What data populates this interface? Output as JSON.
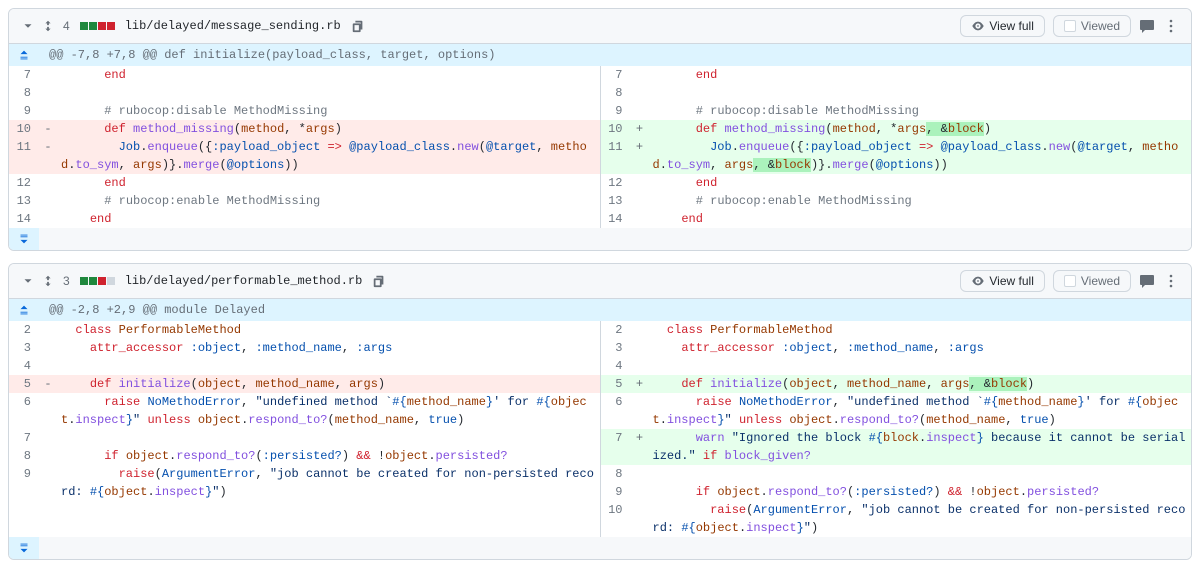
{
  "ui": {
    "view_full": "View full",
    "viewed": "Viewed",
    "eye": "eye-icon",
    "comment": "comment-icon",
    "kebab": "kebab-icon"
  },
  "files": [
    {
      "path": "lib/delayed/message_sending.rb",
      "change_count": "4",
      "diffstat": [
        "add",
        "add",
        "del",
        "del"
      ],
      "hunk_header": "@@ -7,8 +7,8 @@ def initialize(payload_class, target, options)",
      "left": [
        {
          "n": "7",
          "m": "",
          "type": "ctx",
          "html": "      <span class='kw-red'>end</span>"
        },
        {
          "n": "8",
          "m": "",
          "type": "ctx",
          "html": ""
        },
        {
          "n": "9",
          "m": "",
          "type": "ctx",
          "html": "      <span class='kw-gray'># rubocop:disable MethodMissing</span>"
        },
        {
          "n": "10",
          "m": "-",
          "type": "del",
          "html": "      <span class='kw-red'>def</span> <span class='kw-purple'>method_missing</span>(<span class='kw-orange'>method</span>, *<span class='kw-orange'>args</span>)"
        },
        {
          "n": "11",
          "m": "-",
          "type": "del",
          "html": "        <span class='kw-blue'>Job</span>.<span class='kw-purple'>enqueue</span>({<span class='kw-blue'>:payload_object</span> <span class='kw-red'>=&gt;</span> <span class='kw-blue'>@payload_class</span>.<span class='kw-purple'>new</span>(<span class='kw-blue'>@target</span>, <span class='kw-orange'>method</span>.<span class='kw-purple'>to_sym</span>, <span class='kw-orange'>args</span>)}.<span class='kw-purple'>merge</span>(<span class='kw-blue'>@options</span>))"
        },
        {
          "n": "12",
          "m": "",
          "type": "ctx",
          "html": "      <span class='kw-red'>end</span>"
        },
        {
          "n": "13",
          "m": "",
          "type": "ctx",
          "html": "      <span class='kw-gray'># rubocop:enable MethodMissing</span>"
        },
        {
          "n": "14",
          "m": "",
          "type": "ctx",
          "html": "    <span class='kw-red'>end</span>"
        }
      ],
      "right": [
        {
          "n": "7",
          "m": "",
          "type": "ctx",
          "html": "      <span class='kw-red'>end</span>"
        },
        {
          "n": "8",
          "m": "",
          "type": "ctx",
          "html": ""
        },
        {
          "n": "9",
          "m": "",
          "type": "ctx",
          "html": "      <span class='kw-gray'># rubocop:disable MethodMissing</span>"
        },
        {
          "n": "10",
          "m": "+",
          "type": "add",
          "html": "      <span class='kw-red'>def</span> <span class='kw-purple'>method_missing</span>(<span class='kw-orange'>method</span>, *<span class='kw-orange'>args</span><span class='hl-add'>, &amp;<span class='kw-orange'>block</span></span>)"
        },
        {
          "n": "11",
          "m": "+",
          "type": "add",
          "html": "        <span class='kw-blue'>Job</span>.<span class='kw-purple'>enqueue</span>({<span class='kw-blue'>:payload_object</span> <span class='kw-red'>=&gt;</span> <span class='kw-blue'>@payload_class</span>.<span class='kw-purple'>new</span>(<span class='kw-blue'>@target</span>, <span class='kw-orange'>method</span>.<span class='kw-purple'>to_sym</span>, <span class='kw-orange'>args</span><span class='hl-add'>, &amp;<span class='kw-orange'>block</span></span>)}.<span class='kw-purple'>merge</span>(<span class='kw-blue'>@options</span>))"
        },
        {
          "n": "12",
          "m": "",
          "type": "ctx",
          "html": "      <span class='kw-red'>end</span>"
        },
        {
          "n": "13",
          "m": "",
          "type": "ctx",
          "html": "      <span class='kw-gray'># rubocop:enable MethodMissing</span>"
        },
        {
          "n": "14",
          "m": "",
          "type": "ctx",
          "html": "    <span class='kw-red'>end</span>"
        }
      ]
    },
    {
      "path": "lib/delayed/performable_method.rb",
      "change_count": "3",
      "diffstat": [
        "add",
        "add",
        "del",
        "neutral"
      ],
      "hunk_header": "@@ -2,8 +2,9 @@ module Delayed",
      "left": [
        {
          "n": "2",
          "m": "",
          "type": "ctx",
          "html": "  <span class='kw-red'>class</span> <span class='kw-orange'>PerformableMethod</span>"
        },
        {
          "n": "3",
          "m": "",
          "type": "ctx",
          "html": "    <span class='kw-red'>attr_accessor</span> <span class='kw-blue'>:object</span>, <span class='kw-blue'>:method_name</span>, <span class='kw-blue'>:args</span>"
        },
        {
          "n": "4",
          "m": "",
          "type": "ctx",
          "html": ""
        },
        {
          "n": "5",
          "m": "-",
          "type": "del",
          "html": "    <span class='kw-red'>def</span> <span class='kw-purple'>initialize</span>(<span class='kw-orange'>object</span>, <span class='kw-orange'>method_name</span>, <span class='kw-orange'>args</span>)"
        },
        {
          "n": "6",
          "m": "",
          "type": "ctx",
          "html": "      <span class='kw-red'>raise</span> <span class='kw-blue'>NoMethodError</span>, <span class='kw-navy'>\"undefined method `</span><span class='kw-blue'>#{</span><span class='kw-orange'>method_name</span><span class='kw-blue'>}</span><span class='kw-navy'>' for </span><span class='kw-blue'>#{</span><span class='kw-orange'>object</span>.<span class='kw-purple'>inspect</span><span class='kw-blue'>}</span><span class='kw-navy'>\"</span> <span class='kw-red'>unless</span> <span class='kw-orange'>object</span>.<span class='kw-purple'>respond_to?</span>(<span class='kw-orange'>method_name</span>, <span class='kw-blue'>true</span>)"
        },
        {
          "n": "",
          "m": "",
          "type": "blank",
          "html": ""
        },
        {
          "n": "7",
          "m": "",
          "type": "ctx",
          "html": ""
        },
        {
          "n": "8",
          "m": "",
          "type": "ctx",
          "html": "      <span class='kw-red'>if</span> <span class='kw-orange'>object</span>.<span class='kw-purple'>respond_to?</span>(<span class='kw-blue'>:persisted?</span>) <span class='kw-red'>&amp;&amp;</span> !<span class='kw-orange'>object</span>.<span class='kw-purple'>persisted?</span>"
        },
        {
          "n": "9",
          "m": "",
          "type": "ctx",
          "html": "        <span class='kw-red'>raise</span>(<span class='kw-blue'>ArgumentError</span>, <span class='kw-navy'>\"job cannot be created for non-persisted record: </span><span class='kw-blue'>#{</span><span class='kw-orange'>object</span>.<span class='kw-purple'>inspect</span><span class='kw-blue'>}</span><span class='kw-navy'>\"</span>)"
        }
      ],
      "right": [
        {
          "n": "2",
          "m": "",
          "type": "ctx",
          "html": "  <span class='kw-red'>class</span> <span class='kw-orange'>PerformableMethod</span>"
        },
        {
          "n": "3",
          "m": "",
          "type": "ctx",
          "html": "    <span class='kw-red'>attr_accessor</span> <span class='kw-blue'>:object</span>, <span class='kw-blue'>:method_name</span>, <span class='kw-blue'>:args</span>"
        },
        {
          "n": "4",
          "m": "",
          "type": "ctx",
          "html": ""
        },
        {
          "n": "5",
          "m": "+",
          "type": "add",
          "html": "    <span class='kw-red'>def</span> <span class='kw-purple'>initialize</span>(<span class='kw-orange'>object</span>, <span class='kw-orange'>method_name</span>, <span class='kw-orange'>args</span><span class='hl-add'>, &amp;<span class='kw-orange'>block</span></span>)"
        },
        {
          "n": "6",
          "m": "",
          "type": "ctx",
          "html": "      <span class='kw-red'>raise</span> <span class='kw-blue'>NoMethodError</span>, <span class='kw-navy'>\"undefined method `</span><span class='kw-blue'>#{</span><span class='kw-orange'>method_name</span><span class='kw-blue'>}</span><span class='kw-navy'>' for </span><span class='kw-blue'>#{</span><span class='kw-orange'>object</span>.<span class='kw-purple'>inspect</span><span class='kw-blue'>}</span><span class='kw-navy'>\"</span> <span class='kw-red'>unless</span> <span class='kw-orange'>object</span>.<span class='kw-purple'>respond_to?</span>(<span class='kw-orange'>method_name</span>, <span class='kw-blue'>true</span>)"
        },
        {
          "n": "7",
          "m": "+",
          "type": "add",
          "html": "      <span class='kw-purple'>warn</span> <span class='kw-navy'>\"Ignored the block </span><span class='kw-blue'>#{</span><span class='kw-orange'>block</span>.<span class='kw-purple'>inspect</span><span class='kw-blue'>}</span><span class='kw-navy'> because it cannot be serialized.\"</span> <span class='kw-red'>if</span> <span class='kw-purple'>block_given?</span>"
        },
        {
          "n": "8",
          "m": "",
          "type": "ctx",
          "html": ""
        },
        {
          "n": "9",
          "m": "",
          "type": "ctx",
          "html": "      <span class='kw-red'>if</span> <span class='kw-orange'>object</span>.<span class='kw-purple'>respond_to?</span>(<span class='kw-blue'>:persisted?</span>) <span class='kw-red'>&amp;&amp;</span> !<span class='kw-orange'>object</span>.<span class='kw-purple'>persisted?</span>"
        },
        {
          "n": "10",
          "m": "",
          "type": "ctx",
          "html": "        <span class='kw-red'>raise</span>(<span class='kw-blue'>ArgumentError</span>, <span class='kw-navy'>\"job cannot be created for non-persisted record: </span><span class='kw-blue'>#{</span><span class='kw-orange'>object</span>.<span class='kw-purple'>inspect</span><span class='kw-blue'>}</span><span class='kw-navy'>\"</span>)"
        }
      ]
    }
  ]
}
